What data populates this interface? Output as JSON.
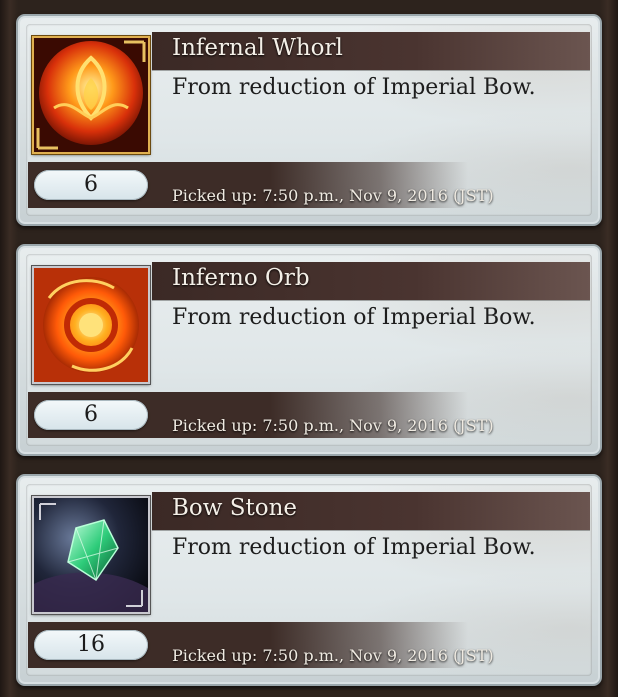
{
  "items": [
    {
      "name": "Infernal Whorl",
      "description": "From reduction of Imperial Bow.",
      "count": "6",
      "picked_up": "Picked up: 7:50 p.m., Nov 9, 2016 (JST)",
      "icon": "flame-whorl-icon"
    },
    {
      "name": "Inferno Orb",
      "description": "From reduction of Imperial Bow.",
      "count": "6",
      "picked_up": "Picked up: 7:50 p.m., Nov 9, 2016 (JST)",
      "icon": "fire-orb-icon"
    },
    {
      "name": "Bow Stone",
      "description": "From reduction of Imperial Bow.",
      "count": "16",
      "picked_up": "Picked up: 7:50 p.m., Nov 9, 2016 (JST)",
      "icon": "green-crystal-icon"
    }
  ],
  "colors": {
    "title_bar": "#3b2925",
    "card_bg": "#e4eaec",
    "pill_bg": "#e6eff3"
  }
}
